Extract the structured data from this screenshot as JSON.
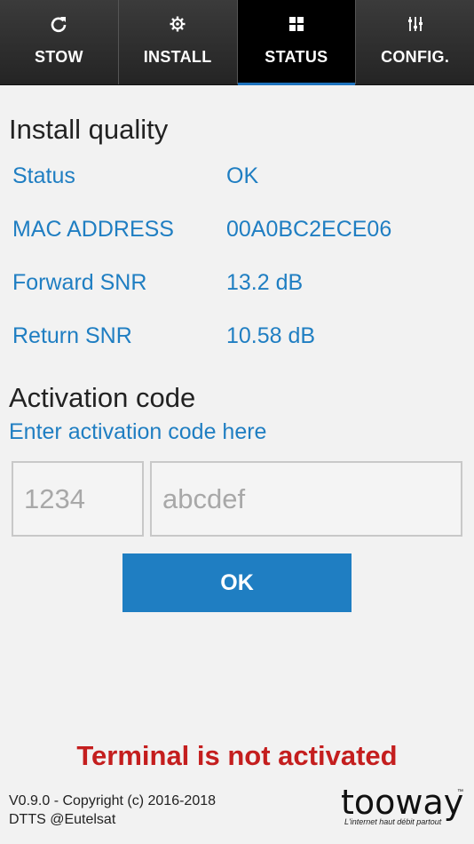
{
  "tabs": [
    {
      "icon": "refresh-icon",
      "label": "STOW",
      "active": false
    },
    {
      "icon": "gear-icon",
      "label": "INSTALL",
      "active": false
    },
    {
      "icon": "grid-icon",
      "label": "STATUS",
      "active": true
    },
    {
      "icon": "sliders-icon",
      "label": "CONFIG.",
      "active": false
    }
  ],
  "install_quality": {
    "title": "Install quality",
    "rows": [
      {
        "label": "Status",
        "value": "OK"
      },
      {
        "label": "MAC ADDRESS",
        "value": "00A0BC2ECE06"
      },
      {
        "label": "Forward SNR",
        "value": "13.2 dB"
      },
      {
        "label": "Return SNR",
        "value": "10.58 dB"
      }
    ]
  },
  "activation": {
    "title": "Activation code",
    "hint": "Enter activation code here",
    "code_part1_placeholder": "1234",
    "code_part2_placeholder": "abcdef",
    "ok_label": "OK"
  },
  "warning": "Terminal is not activated",
  "footer": {
    "line1": "V0.9.0 - Copyright (c) 2016-2018",
    "line2": "DTTS @Eutelsat"
  },
  "logo": {
    "word": "tooway",
    "tm": "™",
    "tagline": "L'internet haut débit partout"
  },
  "colors": {
    "accent": "#1f7ec2",
    "warning": "#c41e1e",
    "tabbar": "#2b2b2b"
  }
}
